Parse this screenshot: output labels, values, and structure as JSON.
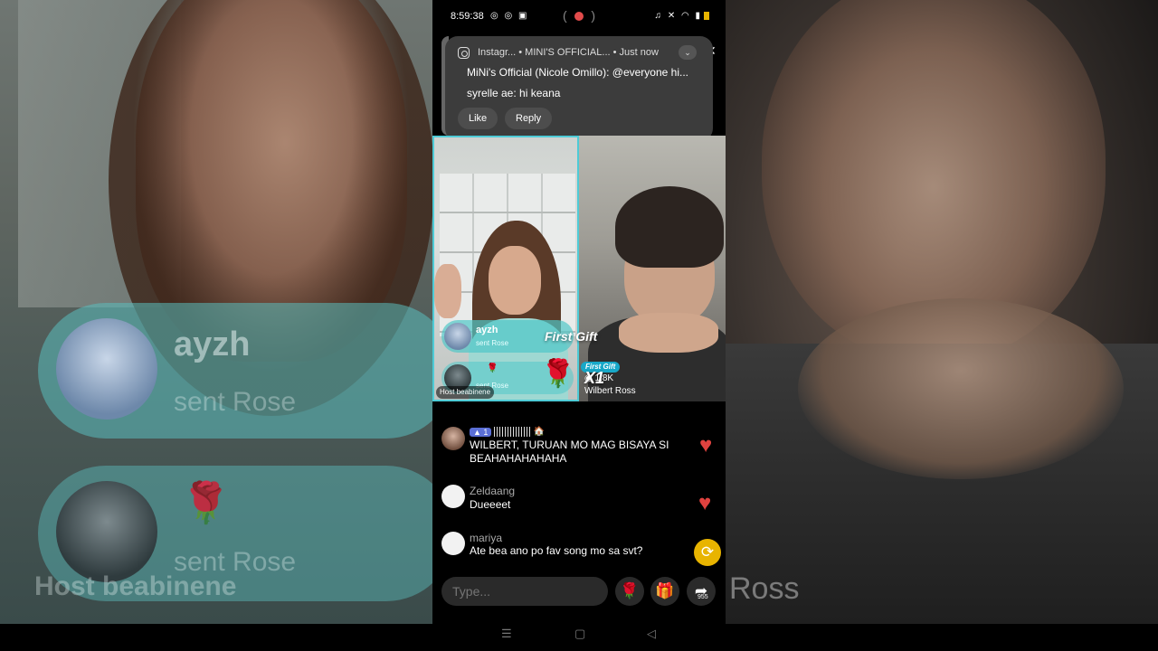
{
  "status": {
    "time": "8:59:38",
    "left_icons": "◎ ◎ ▣",
    "right_icons": "♫ ✕ ◠ ▮"
  },
  "notification": {
    "app": "Instagr...",
    "group": "MINI'S OFFICIAL...",
    "when": "Just now",
    "line1_sender": "MiNi's Official (Nicole Omillo):",
    "line1_text": "@everyone hi...",
    "line2_sender": "syrelle ae:",
    "line2_text": "hi keana",
    "like_label": "Like",
    "reply_label": "Reply"
  },
  "live": {
    "gifts": [
      {
        "user": "ayzh",
        "action": "sent Rose"
      },
      {
        "user": "",
        "action": "sent Rose"
      }
    ],
    "first_gift_banner": "First Gift",
    "first_gift_badge": "First Gift",
    "multiplier": "X1",
    "likes": "1.8K",
    "host_tag": "Host",
    "host_name": "beabinene",
    "guest_name": "Wilbert Ross"
  },
  "chat": [
    {
      "user": "",
      "level": "1",
      "message": "WILBERT, TURUAN MO MAG BISAYA SI BEAHAHAHAHAHA"
    },
    {
      "user": "Zeldaang",
      "message": "Dueeeet"
    },
    {
      "user": "mariya",
      "message": "Ate bea ano po fav song mo sa svt?"
    }
  ],
  "input": {
    "placeholder": "Type..."
  },
  "actions": {
    "share_count": "955"
  },
  "icons": {
    "rose": "🌹",
    "gift": "🎁",
    "share": "➦",
    "repost": "⟳",
    "heart": "♥"
  },
  "background": {
    "left_user": "ayzh",
    "left_sub": "sent Rose",
    "left_sub2": "sent Rose",
    "left_host": "Host",
    "left_host_name": "beabinene",
    "right_name": "Ross"
  },
  "nav": {
    "recents": "☰",
    "home": "▢",
    "back": "◁"
  },
  "colors": {
    "accent": "#4ecbd6",
    "heart": "#e0423f",
    "repost": "#e8b400"
  }
}
